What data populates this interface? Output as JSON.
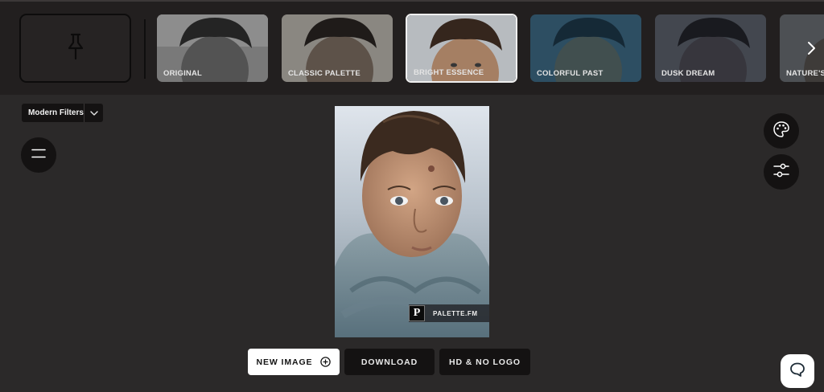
{
  "filter_bar": {
    "pin_icon": "pushpin-icon",
    "thumbnails": [
      {
        "label": "ORIGINAL",
        "selected": false
      },
      {
        "label": "CLASSIC PALETTE",
        "selected": false
      },
      {
        "label": "BRIGHT ESSENCE",
        "selected": true
      },
      {
        "label": "COLORFUL PAST",
        "selected": false
      },
      {
        "label": "DUSK DREAM",
        "selected": false
      },
      {
        "label": "NATURE'S",
        "selected": false
      }
    ],
    "next_icon": "chevron-right-icon"
  },
  "filter_set": {
    "selected": "Modern Filters",
    "icon": "chevron-down-icon"
  },
  "side_tools": {
    "menu_icon": "hamburger-menu-icon",
    "palette_icon": "palette-icon",
    "sliders_icon": "sliders-icon"
  },
  "preview": {
    "watermark_logo": "P",
    "watermark_text": "PALETTE.FM"
  },
  "actions": {
    "new_image": "NEW IMAGE",
    "download": "DOWNLOAD",
    "hd_no_logo": "HD & NO LOGO"
  },
  "chat": {
    "icon": "chat-bubble-icon"
  }
}
